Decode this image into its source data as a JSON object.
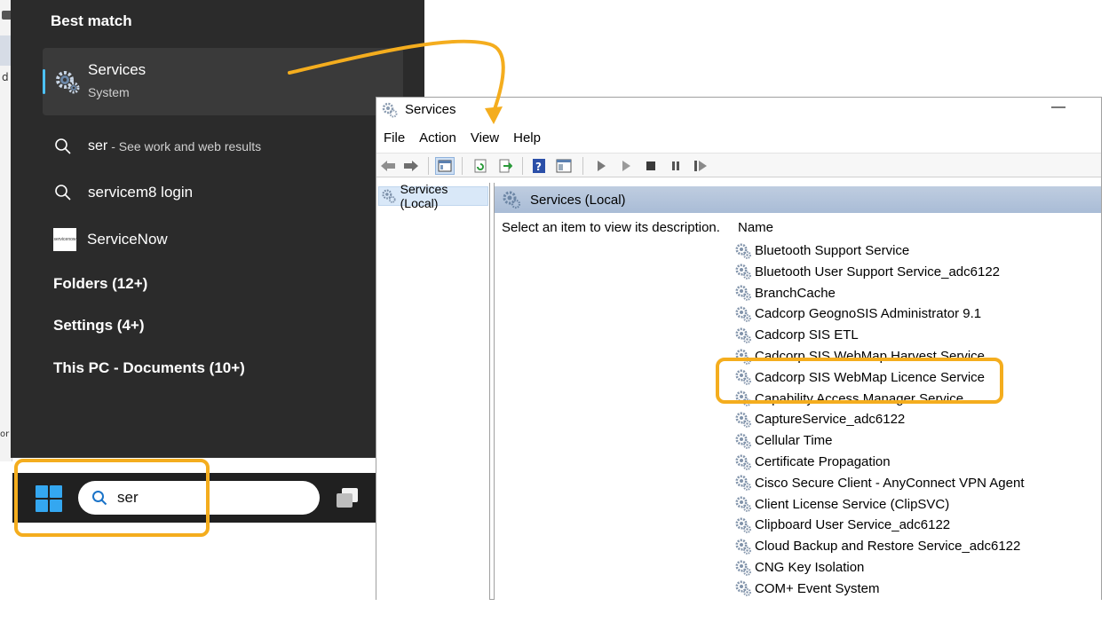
{
  "background_fragments": {
    "left_text_1": "d",
    "left_text_2": "or"
  },
  "start_menu": {
    "best_match_heading": "Best match",
    "best_match": {
      "name": "Services",
      "type": "System",
      "icon": "gears-icon"
    },
    "results": [
      {
        "query": "ser",
        "suffix": "- See work and web results",
        "icon": "search-icon"
      },
      {
        "label": "servicem8 login",
        "icon": "search-icon"
      },
      {
        "label": "ServiceNow",
        "icon": "servicenow-logo",
        "logo_text": "servicenow"
      }
    ],
    "groups": [
      "Folders (12+)",
      "Settings (4+)",
      "This PC - Documents (10+)"
    ]
  },
  "taskbar": {
    "search_value": "ser",
    "accent": "#34a7f0"
  },
  "services_window": {
    "title": "Services",
    "minimize": "—",
    "menu": [
      "File",
      "Action",
      "View",
      "Help"
    ],
    "tree_item": "Services (Local)",
    "header": "Services (Local)",
    "description": "Select an item to view its description.",
    "column_name": "Name",
    "services": [
      "Bluetooth Support Service",
      "Bluetooth User Support Service_adc6122",
      "BranchCache",
      "Cadcorp GeognoSIS Administrator 9.1",
      "Cadcorp SIS ETL",
      "Cadcorp SIS WebMap Harvest Service",
      "Cadcorp SIS WebMap Licence Service",
      "Capability Access Manager Service",
      "CaptureService_adc6122",
      "Cellular Time",
      "Certificate Propagation",
      "Cisco Secure Client - AnyConnect VPN Agent",
      "Client License Service (ClipSVC)",
      "Clipboard User Service_adc6122",
      "Cloud Backup and Restore Service_adc6122",
      "CNG Key Isolation",
      "COM+ Event System"
    ]
  },
  "colors": {
    "highlight": "#f4ad1e",
    "start_bg": "#2b2b2b",
    "header_blue": "#b4c6dc"
  }
}
